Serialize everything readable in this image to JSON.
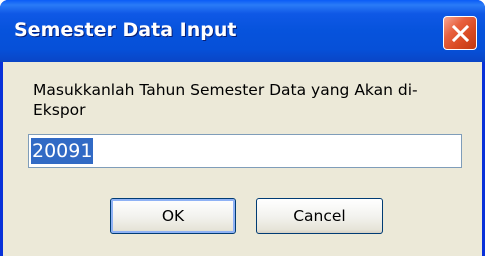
{
  "dialog": {
    "title": "Semester Data Input",
    "prompt": "Masukkanlah Tahun Semester Data yang Akan di-Ekspor",
    "input_value": "20091",
    "ok_label": "OK",
    "cancel_label": "Cancel"
  },
  "icons": {
    "close": "close-icon"
  },
  "colors": {
    "titlebar": "#0653dc",
    "client_bg": "#ece9d8",
    "close_btn": "#d94a22",
    "selection": "#316ac5",
    "input_border": "#7f9db9"
  }
}
